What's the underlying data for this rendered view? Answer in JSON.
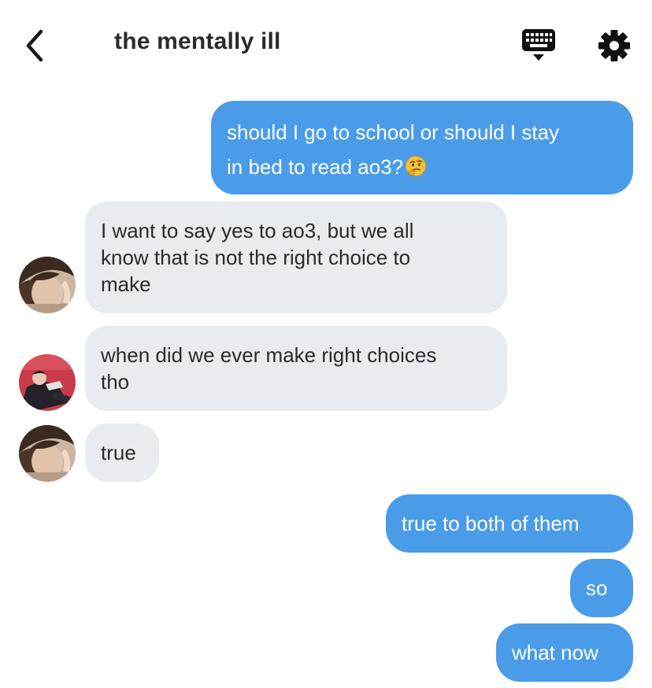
{
  "header": {
    "title": "the mentally ill",
    "back_icon": "chevron-left-icon",
    "keyboard_icon": "keyboard-icon",
    "settings_icon": "gear-icon"
  },
  "colors": {
    "outgoing_bubble": "#4a9ce8",
    "incoming_bubble": "#e8ebf0",
    "text": "#222222"
  },
  "messages": [
    {
      "direction": "outgoing",
      "line1": "should I go to school or should I stay",
      "line2": "in bed to read ao3?",
      "emoji": "thinking-face-emoji"
    },
    {
      "direction": "incoming",
      "sender_avatar": "avatar-1",
      "line1": "I want to say yes to ao3, but we all",
      "line2": "know that is not the right choice to",
      "line3": "make"
    },
    {
      "direction": "incoming",
      "sender_avatar": "avatar-2",
      "line1": "when did we ever make right choices",
      "line2": "tho"
    },
    {
      "direction": "incoming",
      "sender_avatar": "avatar-1",
      "text": "true"
    },
    {
      "direction": "outgoing",
      "text": "true to both of them"
    },
    {
      "direction": "outgoing",
      "text": "so"
    },
    {
      "direction": "outgoing",
      "text": "what now"
    }
  ]
}
